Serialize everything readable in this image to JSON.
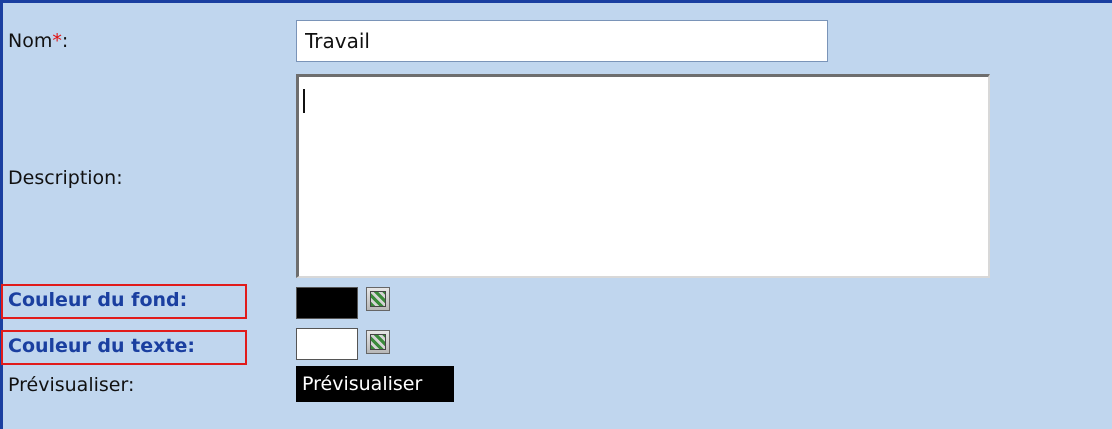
{
  "form": {
    "name_label": "Nom",
    "required_mark": "*",
    "colon": ":",
    "name_value": "Travail",
    "description_label": "Description:",
    "description_value": "",
    "bg_color_label": "Couleur du fond",
    "text_color_label": "Couleur du texte",
    "preview_label": "Prévisualiser:",
    "preview_button": "Prévisualiser"
  },
  "colors": {
    "background_swatch": "#000000",
    "text_swatch": "#ffffff",
    "highlight_box": "#e11b1b",
    "page_background": "#c0d6ee"
  },
  "icons": {
    "color_picker": "color-picker-icon"
  }
}
